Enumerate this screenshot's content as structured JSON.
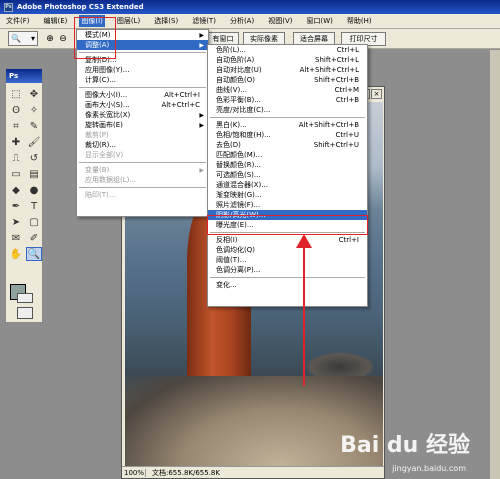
{
  "window": {
    "title": "Adobe Photoshop CS3 Extended"
  },
  "menubar": {
    "items": [
      "文件(F)",
      "编辑(E)",
      "图像(I)",
      "图层(L)",
      "选择(S)",
      "滤镜(T)",
      "分析(A)",
      "视图(V)",
      "窗口(W)",
      "帮助(H)"
    ],
    "active_index": 2
  },
  "optionsbar": {
    "buttons": [
      "有窗口",
      "实际像素",
      "适合屏幕",
      "打印尺寸"
    ]
  },
  "toolbox": {
    "title": "Ps"
  },
  "image_menu": {
    "items": [
      {
        "label": "模式(M)",
        "shortcut": "",
        "submenu": true,
        "disabled": false
      },
      {
        "label": "调整(A)",
        "shortcut": "",
        "submenu": true,
        "disabled": false,
        "highlighted": true
      },
      {
        "sep": true
      },
      {
        "label": "复制(D)...",
        "shortcut": "",
        "disabled": false
      },
      {
        "label": "应用图像(Y)...",
        "shortcut": "",
        "disabled": false
      },
      {
        "label": "计算(C)...",
        "shortcut": "",
        "disabled": false
      },
      {
        "sep": true
      },
      {
        "label": "图像大小(I)...",
        "shortcut": "Alt+Ctrl+I",
        "disabled": false
      },
      {
        "label": "画布大小(S)...",
        "shortcut": "Alt+Ctrl+C",
        "disabled": false
      },
      {
        "label": "像素长宽比(X)",
        "shortcut": "",
        "submenu": true,
        "disabled": false
      },
      {
        "label": "旋转画布(E)",
        "shortcut": "",
        "submenu": true,
        "disabled": false
      },
      {
        "label": "裁剪(P)",
        "shortcut": "",
        "disabled": true
      },
      {
        "label": "裁切(R)...",
        "shortcut": "",
        "disabled": false
      },
      {
        "label": "显示全部(V)",
        "shortcut": "",
        "disabled": true
      },
      {
        "sep": true
      },
      {
        "label": "变量(B)",
        "shortcut": "",
        "submenu": true,
        "disabled": true
      },
      {
        "label": "应用数据组(L)...",
        "shortcut": "",
        "disabled": true
      },
      {
        "sep": true
      },
      {
        "label": "陷印(T)...",
        "shortcut": "",
        "disabled": true
      }
    ]
  },
  "adjust_menu": {
    "items": [
      {
        "label": "色阶(L)...",
        "shortcut": "Ctrl+L"
      },
      {
        "label": "自动色阶(A)",
        "shortcut": "Shift+Ctrl+L"
      },
      {
        "label": "自动对比度(U)",
        "shortcut": "Alt+Shift+Ctrl+L"
      },
      {
        "label": "自动颜色(O)",
        "shortcut": "Shift+Ctrl+B"
      },
      {
        "label": "曲线(V)...",
        "shortcut": "Ctrl+M"
      },
      {
        "label": "色彩平衡(B)...",
        "shortcut": "Ctrl+B"
      },
      {
        "label": "亮度/对比度(C)...",
        "shortcut": ""
      },
      {
        "sep": true
      },
      {
        "label": "黑白(K)...",
        "shortcut": "Alt+Shift+Ctrl+B"
      },
      {
        "label": "色相/饱和度(H)...",
        "shortcut": "Ctrl+U"
      },
      {
        "label": "去色(D)",
        "shortcut": "Shift+Ctrl+U"
      },
      {
        "label": "匹配颜色(M)...",
        "shortcut": ""
      },
      {
        "label": "替换颜色(R)...",
        "shortcut": ""
      },
      {
        "label": "可选颜色(S)...",
        "shortcut": ""
      },
      {
        "label": "通道混合器(X)...",
        "shortcut": ""
      },
      {
        "label": "渐变映射(G)...",
        "shortcut": ""
      },
      {
        "label": "照片滤镜(F)...",
        "shortcut": ""
      },
      {
        "label": "阴影/高光(W)...",
        "shortcut": "",
        "highlighted": true
      },
      {
        "label": "曝光度(E)...",
        "shortcut": ""
      },
      {
        "sep": true
      },
      {
        "label": "反相(I)",
        "shortcut": "Ctrl+I"
      },
      {
        "label": "色调均化(Q)",
        "shortcut": ""
      },
      {
        "label": "阈值(T)...",
        "shortcut": ""
      },
      {
        "label": "色调分离(P)...",
        "shortcut": ""
      },
      {
        "sep": true
      },
      {
        "label": "变化...",
        "shortcut": ""
      }
    ]
  },
  "document": {
    "zoom": "100%",
    "docsize": "文档:655.8K/655.8K"
  },
  "watermark": {
    "brand": "Bai du 经验",
    "sub": "jingyan.baidu.com"
  },
  "colors": {
    "highlight": "#316ac5",
    "annotation": "#e0232b",
    "titlebar": "#0b2a8a"
  }
}
